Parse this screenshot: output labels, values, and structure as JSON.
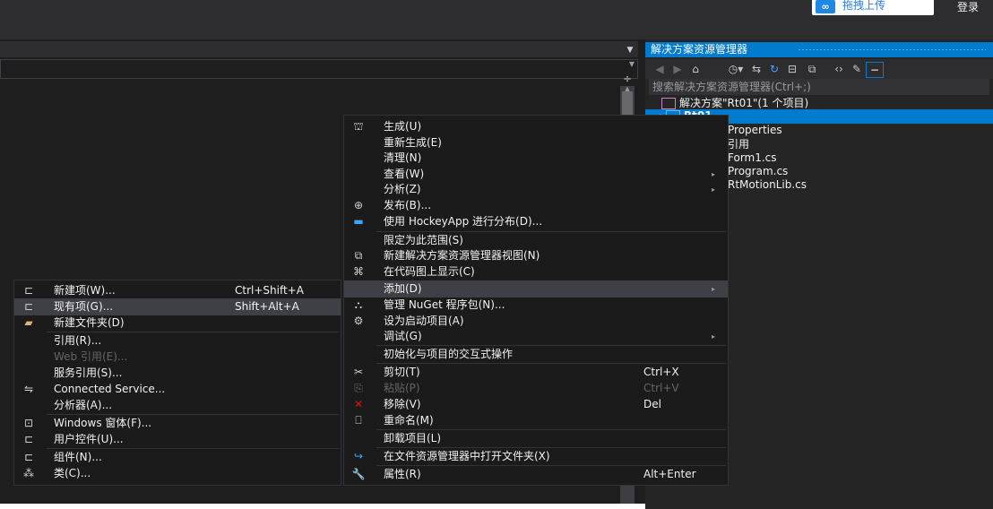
{
  "topbar": {
    "share_icon": "∞",
    "share_label": "拖拽上传",
    "login_label": "登录"
  },
  "solution_explorer": {
    "title": "解决方案资源管理器",
    "search_placeholder": "搜索解决方案资源管理器(Ctrl+;)",
    "toolbar_icons": [
      "back-icon",
      "forward-icon",
      "home-icon",
      "history-icon",
      "sync-icon",
      "refresh-icon",
      "collapse-all-icon",
      "show-all-files-icon",
      "code-view-icon",
      "properties-icon",
      "pin-icon"
    ],
    "tree": {
      "solution": "解决方案\"Rt01\"(1 个项目)",
      "project": "Rt01",
      "items": [
        "Properties",
        "引用",
        "Form1.cs",
        "Program.cs",
        "RtMotionLib.cs"
      ]
    }
  },
  "context_menu": {
    "items": [
      {
        "label": "生成(U)",
        "icon": "build-icon"
      },
      {
        "label": "重新生成(E)"
      },
      {
        "label": "清理(N)"
      },
      {
        "label": "查看(W)",
        "submenu": true
      },
      {
        "label": "分析(Z)",
        "submenu": true
      },
      {
        "label": "发布(B)...",
        "icon": "publish-icon"
      },
      {
        "label": "使用 HockeyApp 进行分布(D)...",
        "icon": "hockeyapp-icon"
      },
      {
        "label": "限定为此范围(S)"
      },
      {
        "label": "新建解决方案资源管理器视图(N)",
        "icon": "new-view-icon"
      },
      {
        "label": "在代码图上显示(C)",
        "icon": "code-map-icon"
      },
      {
        "label": "添加(D)",
        "submenu": true,
        "highlighted": true
      },
      {
        "label": "管理 NuGet 程序包(N)...",
        "icon": "nuget-icon"
      },
      {
        "label": "设为启动项目(A)",
        "icon": "gear-icon"
      },
      {
        "label": "调试(G)",
        "submenu": true
      },
      {
        "label": "初始化与项目的交互式操作"
      },
      {
        "label": "剪切(T)",
        "shortcut": "Ctrl+X",
        "icon": "cut-icon"
      },
      {
        "label": "粘贴(P)",
        "shortcut": "Ctrl+V",
        "icon": "paste-icon",
        "disabled": true
      },
      {
        "label": "移除(V)",
        "shortcut": "Del",
        "icon": "remove-icon"
      },
      {
        "label": "重命名(M)",
        "icon": "rename-icon"
      },
      {
        "label": "卸载项目(L)"
      },
      {
        "label": "在文件资源管理器中打开文件夹(X)",
        "icon": "open-folder-icon"
      },
      {
        "label": "属性(R)",
        "shortcut": "Alt+Enter",
        "icon": "wrench-icon"
      }
    ]
  },
  "add_submenu": {
    "items": [
      {
        "label": "新建项(W)...",
        "shortcut": "Ctrl+Shift+A",
        "icon": "new-item-icon"
      },
      {
        "label": "现有项(G)...",
        "shortcut": "Shift+Alt+A",
        "icon": "existing-item-icon",
        "highlighted": true
      },
      {
        "label": "新建文件夹(D)",
        "icon": "new-folder-icon"
      },
      {
        "label": "引用(R)..."
      },
      {
        "label": "Web 引用(E)...",
        "disabled": true
      },
      {
        "label": "服务引用(S)..."
      },
      {
        "label": "Connected Service...",
        "icon": "connected-service-icon"
      },
      {
        "label": "分析器(A)..."
      },
      {
        "label": "Windows 窗体(F)...",
        "icon": "windows-form-icon"
      },
      {
        "label": "用户控件(U)...",
        "icon": "user-control-icon"
      },
      {
        "label": "组件(N)...",
        "icon": "component-icon"
      },
      {
        "label": "类(C)...",
        "icon": "class-icon"
      }
    ]
  }
}
